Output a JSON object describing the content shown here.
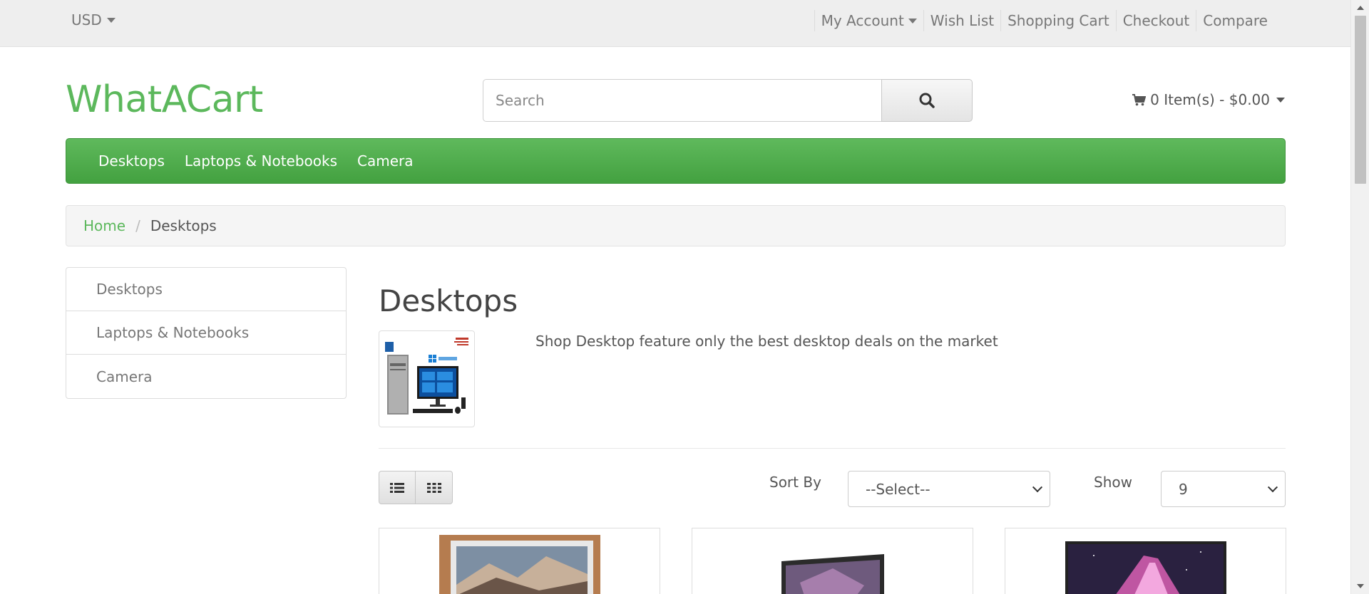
{
  "topbar": {
    "currency": "USD",
    "links": {
      "my_account": "My Account",
      "wish_list": "Wish List",
      "shopping_cart": "Shopping Cart",
      "checkout": "Checkout",
      "compare": "Compare"
    }
  },
  "header": {
    "logo": "WhatACart",
    "search_placeholder": "Search",
    "cart_summary": "0 Item(s) - $0.00"
  },
  "menu": {
    "items": [
      {
        "label": "Desktops"
      },
      {
        "label": "Laptops & Notebooks"
      },
      {
        "label": "Camera"
      }
    ]
  },
  "breadcrumb": {
    "home": "Home",
    "separator": "/",
    "current": "Desktops"
  },
  "sidebar": {
    "items": [
      {
        "label": "Desktops"
      },
      {
        "label": "Laptops & Notebooks"
      },
      {
        "label": "Camera"
      }
    ]
  },
  "category": {
    "title": "Desktops",
    "description": "Shop Desktop feature only the best desktop deals on the market"
  },
  "toolbar": {
    "sort_label": "Sort By",
    "sort_value": "--Select--",
    "show_label": "Show",
    "show_value": "9"
  },
  "colors": {
    "brand_green": "#5cb85c",
    "menu_green_top": "#5fb95c",
    "menu_green_bottom": "#43a140",
    "topbar_bg": "#eeeeee"
  },
  "icons": {
    "currency_caret": "caret-down-icon",
    "search": "search-icon",
    "cart": "shopping-cart-icon",
    "list_view": "list-view-icon",
    "grid_view": "grid-view-icon"
  }
}
